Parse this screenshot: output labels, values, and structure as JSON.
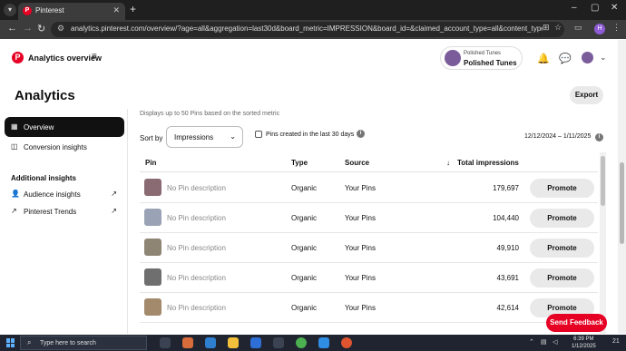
{
  "browser": {
    "tab_title": "Pinterest",
    "url": "analytics.pinterest.com/overview/?age=all&aggregation=last30d&board_metric=IMPRESSION&board_id=&claimed_account_type=all&content_type=all&device_type=..."
  },
  "header": {
    "app_name": "Analytics overview",
    "account_small": "Polished Tunes",
    "account_big": "Polished Tunes"
  },
  "page": {
    "title": "Analytics",
    "export_label": "Export"
  },
  "sidebar": {
    "items": [
      {
        "label": "Overview",
        "icon": "grid-icon"
      },
      {
        "label": "Conversion insights",
        "icon": "conversion-icon"
      }
    ],
    "additional_heading": "Additional insights",
    "additional": [
      {
        "label": "Audience insights",
        "icon": "person-icon"
      },
      {
        "label": "Pinterest Trends",
        "icon": "trend-icon"
      }
    ]
  },
  "controls": {
    "display_note": "Displays up to 50 Pins based on the sorted metric",
    "sort_label": "Sort by",
    "sort_value": "Impressions",
    "checkbox_label": "Pins created in the last 30 days",
    "date_range": "12/12/2024 – 1/11/2025"
  },
  "table": {
    "headers": {
      "pin": "Pin",
      "type": "Type",
      "source": "Source",
      "impressions": "Total impressions"
    },
    "rows": [
      {
        "desc": "No Pin description",
        "type": "Organic",
        "source": "Your Pins",
        "impressions": "179,697",
        "action": "Promote",
        "thumb": "#8a6b74"
      },
      {
        "desc": "No Pin description",
        "type": "Organic",
        "source": "Your Pins",
        "impressions": "104,440",
        "action": "Promote",
        "thumb": "#9aa3b5"
      },
      {
        "desc": "No Pin description",
        "type": "Organic",
        "source": "Your Pins",
        "impressions": "49,910",
        "action": "Promote",
        "thumb": "#8f8574"
      },
      {
        "desc": "No Pin description",
        "type": "Organic",
        "source": "Your Pins",
        "impressions": "43,691",
        "action": "Promote",
        "thumb": "#6f6f6f"
      },
      {
        "desc": "No Pin description",
        "type": "Organic",
        "source": "Your Pins",
        "impressions": "42,614",
        "action": "Promote",
        "thumb": "#a48a6c"
      }
    ]
  },
  "feedback_label": "Send Feedback",
  "taskbar": {
    "search_placeholder": "Type here to search",
    "time": "6:39 PM",
    "date": "1/12/2025",
    "notif": "21"
  },
  "colors": {
    "accent": "#e60023",
    "dark": "#111111"
  }
}
